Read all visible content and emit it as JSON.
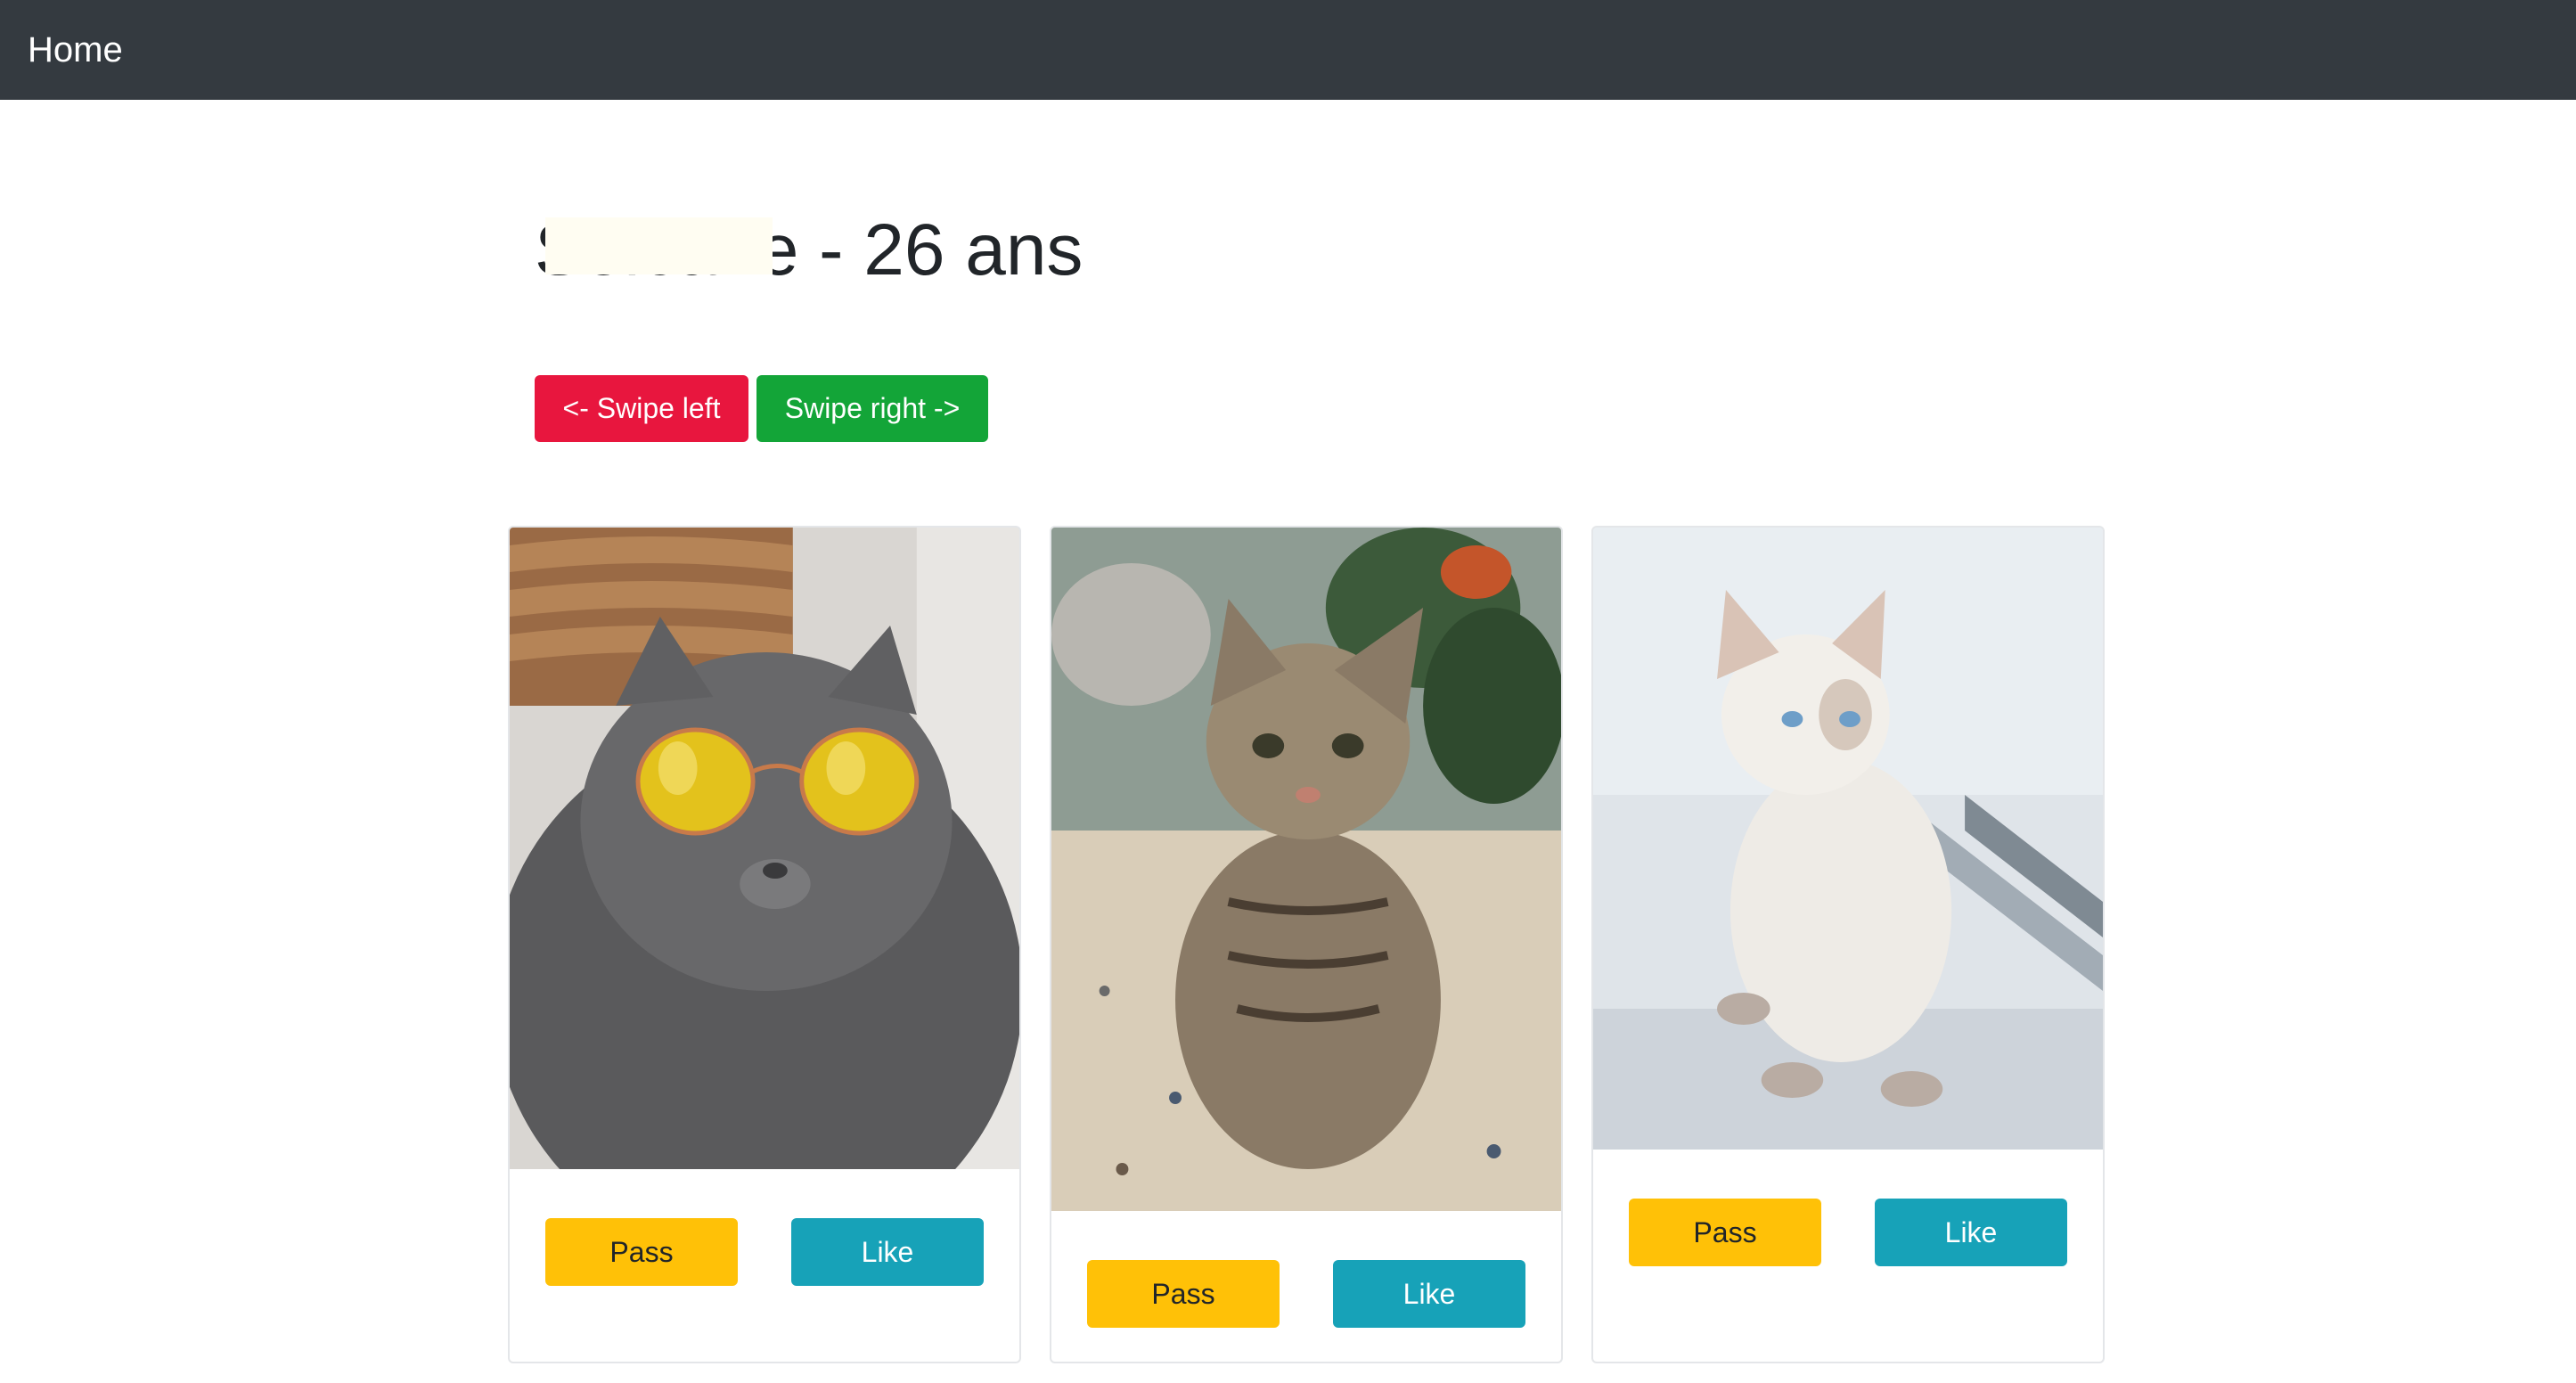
{
  "navbar": {
    "brand": "Home"
  },
  "profile": {
    "name": "Solcane",
    "separator": " - ",
    "age_text": "26 ans"
  },
  "swipe": {
    "left_label": "<- Swipe left",
    "right_label": "Swipe right ->"
  },
  "cards": [
    {
      "photo_icon": "cat-with-sunglasses-photo",
      "pass_label": "Pass",
      "like_label": "Like"
    },
    {
      "photo_icon": "tabby-kitten-photo",
      "pass_label": "Pass",
      "like_label": "Like"
    },
    {
      "photo_icon": "white-kitten-photo",
      "pass_label": "Pass",
      "like_label": "Like"
    }
  ],
  "colors": {
    "navbar": "#343a40",
    "swipe_left": "#e8163e",
    "swipe_right": "#13a538",
    "pass": "#ffc107",
    "like": "#17a2b8"
  }
}
